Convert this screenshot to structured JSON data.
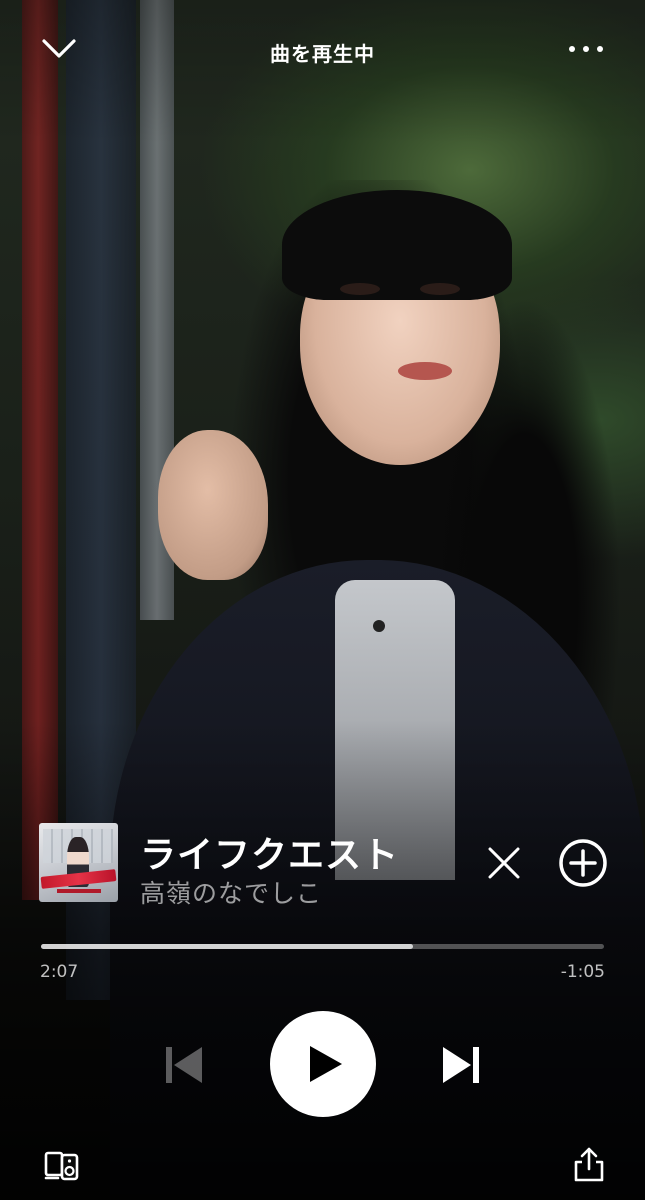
{
  "header": {
    "title": "曲を再生中",
    "collapse_icon": "chevron-down-icon",
    "more_icon": "more-horizontal-icon"
  },
  "track": {
    "title": "ライフクエスト",
    "artist": "高嶺のなでしこ",
    "artwork_icon": "album-artwork"
  },
  "actions": {
    "dismiss_icon": "close-icon",
    "add_icon": "plus-circle-icon"
  },
  "progress": {
    "elapsed": "2:07",
    "remaining": "-1:05",
    "fraction": 0.66
  },
  "controls": {
    "previous_icon": "skip-previous-icon",
    "play_icon": "play-icon",
    "next_icon": "skip-next-icon",
    "previous_enabled": false
  },
  "footer": {
    "device_icon": "connect-device-icon",
    "share_icon": "share-icon"
  },
  "colors": {
    "accent": "#ffffff",
    "progress_track": "#5a5a5a",
    "muted_text": "#9c9c9c"
  }
}
